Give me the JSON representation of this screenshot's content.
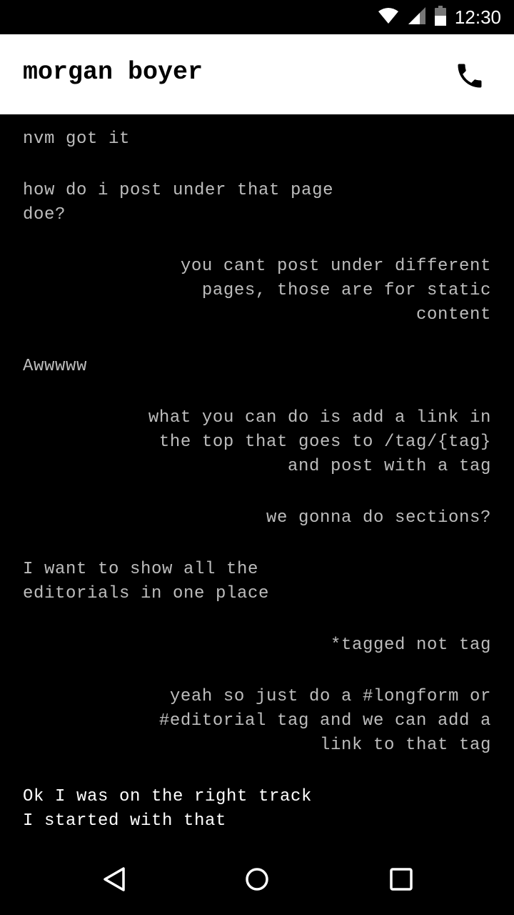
{
  "status_bar": {
    "time": "12:30"
  },
  "app_bar": {
    "title": "morgan boyer",
    "call_icon": "phone-icon"
  },
  "messages": [
    {
      "dir": "in",
      "text": "nvm got it"
    },
    {
      "dir": "in",
      "text": "how do i post under that page\ndoe?"
    },
    {
      "dir": "out",
      "text": "you cant post under different\npages, those are for static\ncontent"
    },
    {
      "dir": "in",
      "text": "Awwwww"
    },
    {
      "dir": "out",
      "text": "what you can do is add a link in\nthe top that goes to /tag/{tag}\nand post with a tag"
    },
    {
      "dir": "out",
      "text": "we gonna do sections?"
    },
    {
      "dir": "in",
      "text": "I want to show all the\neditorials in one place"
    },
    {
      "dir": "out",
      "text": "*tagged not tag"
    },
    {
      "dir": "out",
      "text": "yeah so just do a #longform or\n#editorial tag and we can add a\nlink to that tag"
    },
    {
      "dir": "in",
      "text": "Ok I was on the right track\nI started with that",
      "latest": true
    }
  ],
  "nav_bar": {
    "back_icon": "back-triangle-icon",
    "home_icon": "home-circle-icon",
    "recents_icon": "recents-square-icon"
  }
}
